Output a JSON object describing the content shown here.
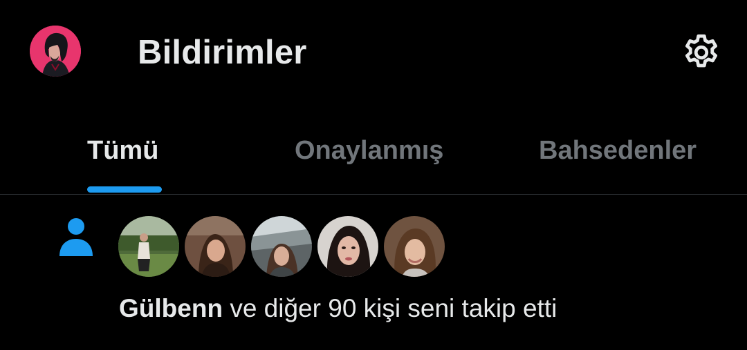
{
  "header": {
    "title": "Bildirimler",
    "avatar_icon": "profile-avatar",
    "settings_icon": "gear-icon"
  },
  "tabs": [
    {
      "label": "Tümü",
      "active": true
    },
    {
      "label": "Onaylanmış",
      "active": false
    },
    {
      "label": "Bahsedenler",
      "active": false
    }
  ],
  "notification": {
    "icon": "person-icon",
    "name": "Gülbenn",
    "text": " ve diğer 90 kişi seni takip etti",
    "follower_count_shown": 5
  },
  "colors": {
    "background": "#000000",
    "text_primary": "#e7e9ea",
    "text_secondary": "#71767b",
    "accent": "#1d9bf0",
    "divider": "#2f3336",
    "avatar_bg": "#e8356d"
  }
}
